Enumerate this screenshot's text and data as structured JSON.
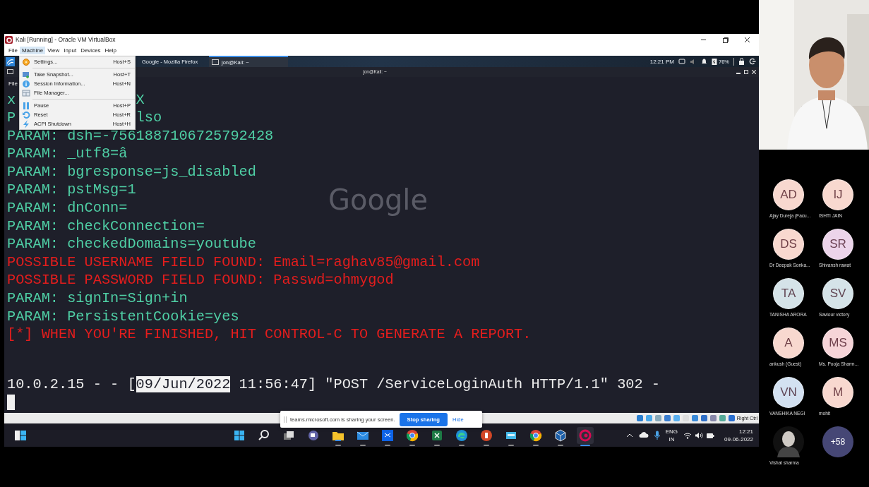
{
  "vbox": {
    "title": "Kali [Running] - Oracle VM VirtualBox",
    "menu": [
      {
        "label": "File",
        "selected": false
      },
      {
        "label": "Machine",
        "selected": true
      },
      {
        "label": "View",
        "selected": false
      },
      {
        "label": "Input",
        "selected": false
      },
      {
        "label": "Devices",
        "selected": false
      },
      {
        "label": "Help",
        "selected": false
      }
    ],
    "host_key": "Right Ctrl"
  },
  "machine_menu": [
    {
      "label": "Settings...",
      "shortcut": "Host+S",
      "kind": "settings"
    },
    {
      "kind": "separator"
    },
    {
      "label": "Take Snapshot...",
      "shortcut": "Host+T",
      "kind": "snapshot"
    },
    {
      "label": "Session Information...",
      "shortcut": "Host+N",
      "kind": "info"
    },
    {
      "label": "File Manager...",
      "kind": "files"
    },
    {
      "kind": "separator"
    },
    {
      "label": "Pause",
      "shortcut": "Host+P",
      "kind": "pause"
    },
    {
      "label": "Reset",
      "shortcut": "Host+R",
      "kind": "reset"
    },
    {
      "label": "ACPI Shutdown",
      "shortcut": "Host+H",
      "kind": "shutdown"
    }
  ],
  "kali_panel": {
    "tasks": [
      {
        "label": "Google - Mozilla Firefox",
        "selected": false
      },
      {
        "label": "jon@Kali: ~",
        "selected": true
      }
    ],
    "clock": "12:21 PM",
    "battery": "76%"
  },
  "terminal": {
    "title": "jon@Kali: ~",
    "menu": "File",
    "watermark": "Google",
    "lines": [
      {
        "kind": "param",
        "text": "x",
        "tail": "X"
      },
      {
        "kind": "param",
        "text": "P",
        "tail": "lso"
      },
      {
        "kind": "param",
        "text": "PARAM: dsh=-7561887106725792428"
      },
      {
        "kind": "param",
        "text": "PARAM: _utf8=â"
      },
      {
        "kind": "param",
        "text": "PARAM: bgresponse=js_disabled"
      },
      {
        "kind": "param",
        "text": "PARAM: pstMsg=1"
      },
      {
        "kind": "param",
        "text": "PARAM: dnConn="
      },
      {
        "kind": "param",
        "text": "PARAM: checkConnection="
      },
      {
        "kind": "param",
        "text": "PARAM: checkedDomains=youtube"
      },
      {
        "kind": "alert",
        "text": "POSSIBLE USERNAME FIELD FOUND: Email=raghav85@gmail.com"
      },
      {
        "kind": "alert",
        "text": "POSSIBLE PASSWORD FIELD FOUND: Passwd=ohmygod"
      },
      {
        "kind": "param",
        "text": "PARAM: signIn=Sign+in"
      },
      {
        "kind": "param",
        "text": "PARAM: PersistentCookie=yes"
      },
      {
        "kind": "alert",
        "text": "[*] WHEN YOU'RE FINISHED, HIT CONTROL-C TO GENERATE A REPORT."
      },
      {
        "kind": "request",
        "parts": [
          {
            "text": "10.0.2.15 - - [",
            "selected": false
          },
          {
            "text": "09/Jun/2022",
            "selected": true
          },
          {
            "text": " 11:56:47] \"POST /ServiceLoginAuth HTTP/1.1\" 302 -",
            "selected": false
          }
        ]
      },
      {
        "kind": "cursor"
      }
    ]
  },
  "share_bar": {
    "message": "teams.microsoft.com is sharing your screen.",
    "stop": "Stop sharing",
    "hide": "Hide"
  },
  "taskbar": {
    "apps": [
      {
        "kind": "start",
        "selected": false
      },
      {
        "kind": "search",
        "selected": false
      },
      {
        "kind": "taskview",
        "selected": false
      },
      {
        "kind": "teams",
        "selected": false
      },
      {
        "kind": "explorer",
        "selected": false
      },
      {
        "kind": "mail",
        "selected": false
      },
      {
        "kind": "dropbox",
        "selected": false
      },
      {
        "kind": "chrome",
        "selected": false
      },
      {
        "kind": "excel",
        "selected": false
      },
      {
        "kind": "edge",
        "selected": false
      },
      {
        "kind": "powerpoint",
        "selected": false
      },
      {
        "kind": "app",
        "selected": false
      },
      {
        "kind": "chrome",
        "selected": false
      },
      {
        "kind": "virtualbox",
        "selected": false
      },
      {
        "kind": "debian",
        "selected": true
      }
    ],
    "language": "ENG",
    "region": "IN",
    "time": "12:21",
    "date": "09-06-2022"
  },
  "meeting": {
    "participants": [
      {
        "kind": "initials",
        "initials": "AD",
        "name": "Ajay Dureja (Facu...",
        "color": "#f8d8cf"
      },
      {
        "kind": "initials",
        "initials": "IJ",
        "name": "ISHTI JAIN",
        "color": "#f8d8cf"
      },
      {
        "kind": "initials",
        "initials": "DS",
        "name": "Dr Deepak Sonka...",
        "color": "#f8d8cf"
      },
      {
        "kind": "initials",
        "initials": "SR",
        "name": "Shivansh rawat",
        "color": "#ecd4ea"
      },
      {
        "kind": "initials",
        "initials": "TA",
        "name": "TANISHA ARORA",
        "color": "#d5e3e8"
      },
      {
        "kind": "initials",
        "initials": "SV",
        "name": "Saviour victory",
        "color": "#d5e3e8"
      },
      {
        "kind": "initials",
        "initials": "A",
        "name": "ankush (Guest)",
        "color": "#f8d8cf"
      },
      {
        "kind": "initials",
        "initials": "MS",
        "name": "Ms. Pooja Sharm...",
        "color": "#f6d4d8"
      },
      {
        "kind": "initials",
        "initials": "VN",
        "name": "VANSHIKA NEGI",
        "color": "#d3e1f1"
      },
      {
        "kind": "initials",
        "initials": "M",
        "name": "mohit",
        "color": "#f8d8cf"
      },
      {
        "name": "Vishal sharma"
      },
      {
        "kind": "overflow",
        "initials": "+58"
      }
    ]
  }
}
